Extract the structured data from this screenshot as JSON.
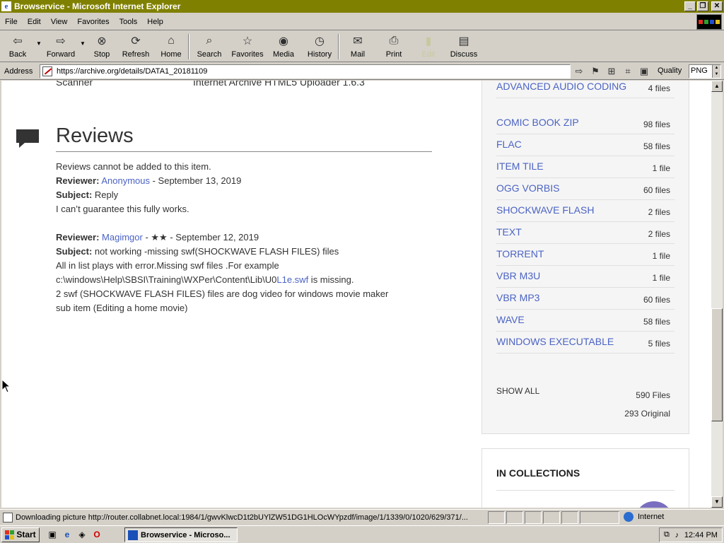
{
  "window": {
    "title": "Browservice - Microsoft Internet Explorer",
    "controls": [
      "_",
      "❐",
      "✕"
    ]
  },
  "menu": [
    "File",
    "Edit",
    "View",
    "Favorites",
    "Tools",
    "Help"
  ],
  "toolbar": {
    "back": "Back",
    "forward": "Forward",
    "stop": "Stop",
    "refresh": "Refresh",
    "home": "Home",
    "search": "Search",
    "favorites": "Favorites",
    "media": "Media",
    "history": "History",
    "mail": "Mail",
    "print": "Print",
    "edit": "Edit",
    "discuss": "Discuss"
  },
  "address": {
    "label": "Address",
    "url": "https://archive.org/details/DATA1_20181109",
    "quality_label": "Quality",
    "quality_value": "PNG"
  },
  "page": {
    "scanner_label": "Scanner",
    "scanner_value": "Internet Archive HTML5 Uploader 1.6.3",
    "reviews_heading": "Reviews",
    "reviews_notice": "Reviews cannot be added to this item.",
    "reviews": [
      {
        "reviewer_label": "Reviewer:",
        "reviewer": "Anonymous",
        "stars": "",
        "date": "September 13, 2019",
        "subject_label": "Subject:",
        "subject": "Reply",
        "body": [
          "I can’t guarantee this fully works."
        ]
      },
      {
        "reviewer_label": "Reviewer:",
        "reviewer": "Magimgor",
        "stars": "★★",
        "date": "September 12, 2019",
        "subject_label": "Subject:",
        "subject": "not working -missing swf(SHOCKWAVE FLASH FILES) files",
        "body": [
          "All in list plays with error.Missing swf files .For example",
          "c:\\windows\\Help\\SBSI\\Training\\WXPer\\Content\\Lib\\U0",
          "L1e.swf",
          " is missing.",
          "2 swf (SHOCKWAVE FLASH FILES) files are dog video for windows movie maker",
          "sub item (Editing a home movie)"
        ]
      }
    ],
    "downloads": [
      {
        "name": "ADVANCED AUDIO CODING",
        "count": "4 files"
      },
      {
        "name": "COMIC BOOK ZIP",
        "count": "98 files"
      },
      {
        "name": "FLAC",
        "count": "58 files"
      },
      {
        "name": "ITEM TILE",
        "count": "1 file"
      },
      {
        "name": "OGG VORBIS",
        "count": "60 files"
      },
      {
        "name": "SHOCKWAVE FLASH",
        "count": "2 files"
      },
      {
        "name": "TEXT",
        "count": "2 files"
      },
      {
        "name": "TORRENT",
        "count": "1 file"
      },
      {
        "name": "VBR M3U",
        "count": "1 file"
      },
      {
        "name": "VBR MP3",
        "count": "60 files"
      },
      {
        "name": "WAVE",
        "count": "58 files"
      },
      {
        "name": "WINDOWS EXECUTABLE",
        "count": "5 files"
      }
    ],
    "show_all": "SHOW ALL",
    "total_files": "590 Files",
    "total_original": "293 Original",
    "collections_title": "IN COLLECTIONS"
  },
  "status": {
    "text": "Downloading picture http://router.collabnet.local:1984/1/gwvKlwcD1t2bUYlZW51DG1HLOcWYpzdf/image/1/1339/0/1020/629/371/...",
    "zone": "Internet"
  },
  "taskbar": {
    "start": "Start",
    "task": "Browservice - Microso...",
    "clock": "12:44 PM"
  },
  "colors": {
    "titlebar": "#808000",
    "link": "#4b63c4"
  }
}
